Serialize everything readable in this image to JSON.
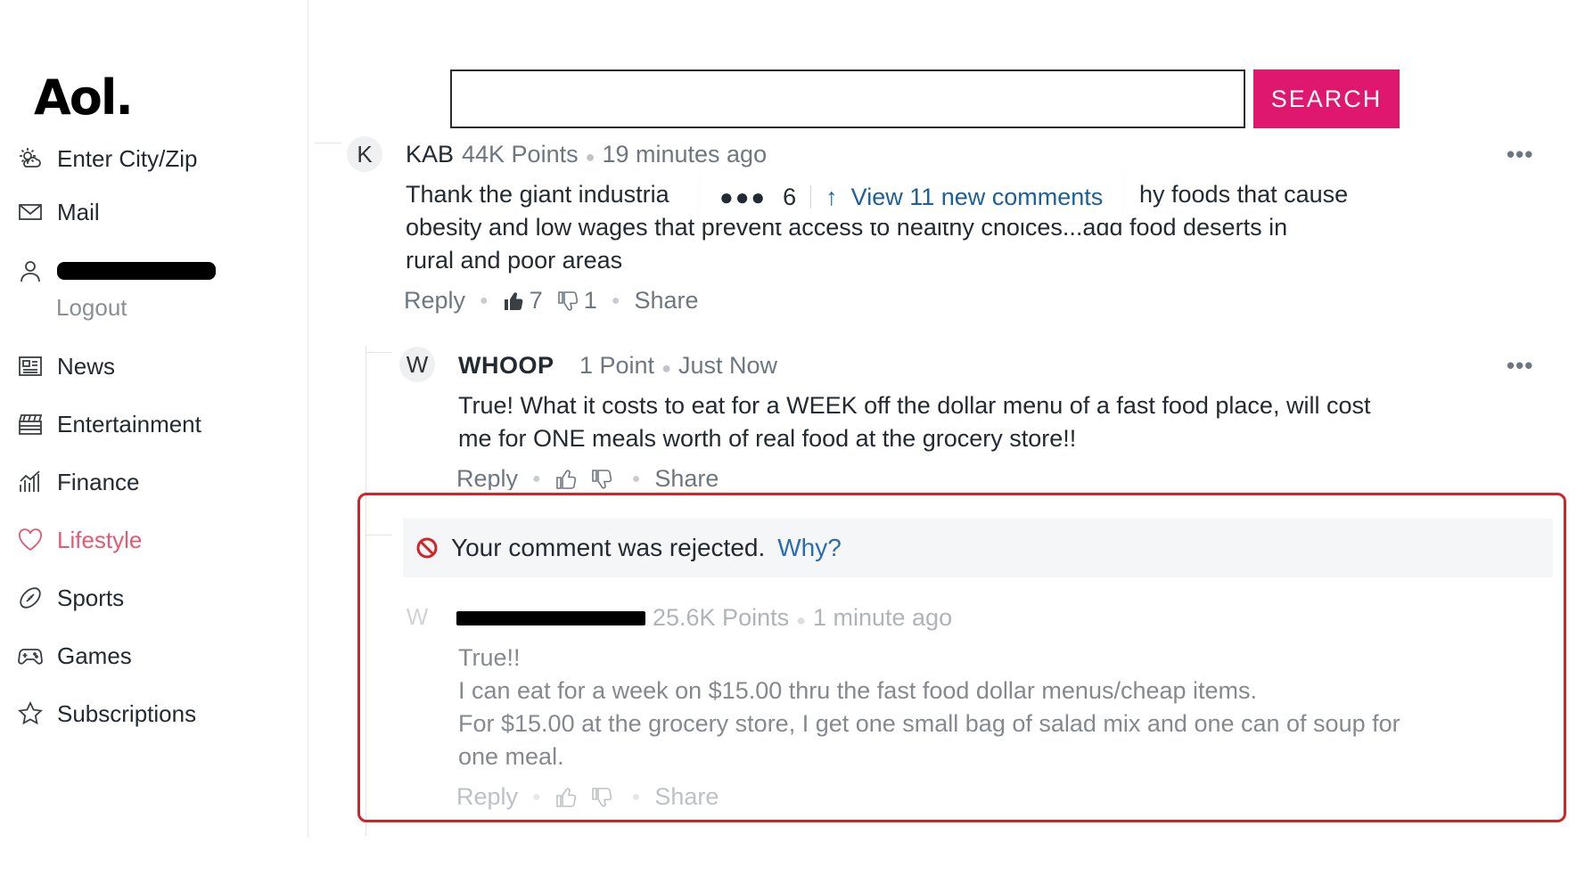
{
  "sidebar": {
    "logo": "Aol.",
    "items": [
      {
        "label": "Enter City/Zip",
        "icon": "weather-icon"
      },
      {
        "label": "Mail",
        "icon": "mail-icon"
      },
      {
        "label": "",
        "icon": "user-icon"
      },
      {
        "label": "News",
        "icon": "news-icon"
      },
      {
        "label": "Entertainment",
        "icon": "clapperboard-icon"
      },
      {
        "label": "Finance",
        "icon": "chart-icon"
      },
      {
        "label": "Lifestyle",
        "icon": "heart-icon"
      },
      {
        "label": "Sports",
        "icon": "football-icon"
      },
      {
        "label": "Games",
        "icon": "gamepad-icon"
      },
      {
        "label": "Subscriptions",
        "icon": "star-icon"
      }
    ],
    "logout": "Logout",
    "active_color": "#e25b72"
  },
  "search": {
    "placeholder": "",
    "button_label": "SEARCH",
    "button_color": "#e0176e"
  },
  "new_comments": {
    "dots": "●●●",
    "count": "6",
    "arrow": "↑",
    "label": "View 11 new comments"
  },
  "comments": [
    {
      "avatar": "K",
      "author": "KAB",
      "points": "44K Points",
      "time": "19 minutes ago",
      "line1_start": "Thank the giant industria",
      "line1_end": "hy foods that cause",
      "line2": "obesity and  low wages that prevent  access to healthy choices...add food deserts in",
      "line3": "rural and poor areas",
      "reply": "Reply",
      "likes": "7",
      "dislikes": "1",
      "share": "Share",
      "more": "•••"
    },
    {
      "avatar": "W",
      "author": "WHOOP",
      "points": "1 Point",
      "time": "Just Now",
      "line1": "True!  What it costs to eat for a WEEK off the dollar menu of a fast food place, will cost",
      "line2": "me for ONE meals worth of real food at the grocery store!!",
      "reply": "Reply",
      "share": "Share",
      "more": "•••"
    }
  ],
  "rejected": {
    "message": "Your comment was rejected.",
    "why": "Why?",
    "frame_color": "#d1232a",
    "comment": {
      "avatar": "W",
      "points": "25.6K Points",
      "time": "1 minute ago",
      "line1": "True!!",
      "line2": "I can eat for a week on $15.00 thru the fast food dollar menus/cheap items.",
      "line3": "For $15.00 at the grocery store, I get one small bag of salad mix and one can of soup for",
      "line4": "one meal.",
      "reply": "Reply",
      "share": "Share"
    }
  }
}
